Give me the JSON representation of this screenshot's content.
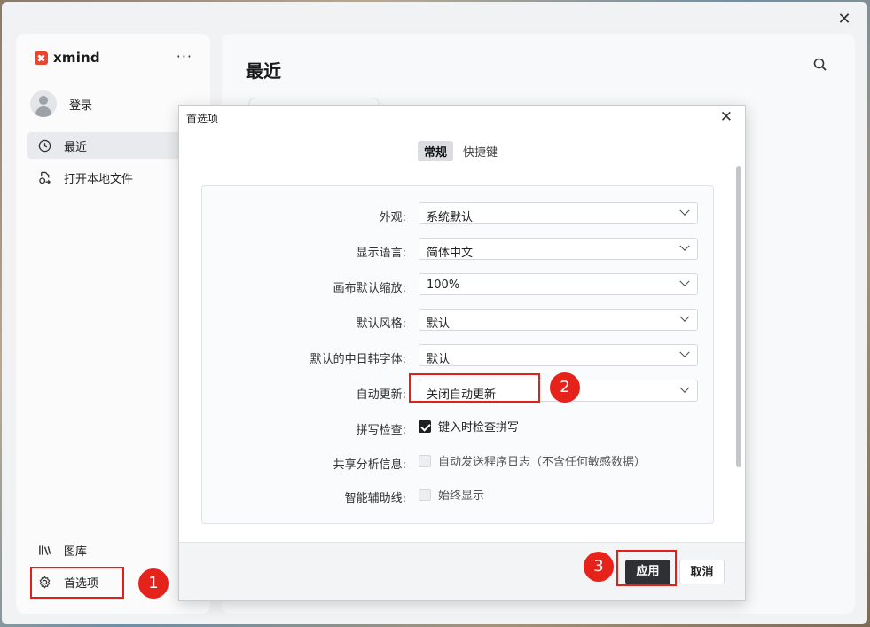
{
  "window": {
    "close_icon": "close-icon"
  },
  "sidebar": {
    "brand": "xmind",
    "more": "···",
    "user_label": "登录",
    "items": [
      {
        "label": "最近",
        "icon": "clock-icon"
      },
      {
        "label": "打开本地文件",
        "icon": "open-file-icon"
      },
      {
        "label": "图库",
        "icon": "library-icon"
      },
      {
        "label": "首选项",
        "icon": "gear-icon"
      }
    ]
  },
  "main": {
    "title": "最近",
    "search_icon": "search-icon"
  },
  "dialog": {
    "title": "首选项",
    "tabs": [
      {
        "label": "常规",
        "active": true
      },
      {
        "label": "快捷键",
        "active": false
      }
    ],
    "settings": [
      {
        "label": "外观:",
        "type": "select",
        "value": "系统默认"
      },
      {
        "label": "显示语言:",
        "type": "select",
        "value": "简体中文"
      },
      {
        "label": "画布默认缩放:",
        "type": "select",
        "value": "100%"
      },
      {
        "label": "默认风格:",
        "type": "select",
        "value": "默认"
      },
      {
        "label": "默认的中日韩字体:",
        "type": "select",
        "value": "默认"
      },
      {
        "label": "自动更新:",
        "type": "select",
        "value": "关闭自动更新"
      },
      {
        "label": "拼写检查:",
        "type": "checkbox",
        "value": "键入时检查拼写",
        "checked": true
      },
      {
        "label": "共享分析信息:",
        "type": "checkbox",
        "value": "自动发送程序日志（不含任何敏感数据）",
        "checked": false
      },
      {
        "label": "智能辅助线:",
        "type": "checkbox",
        "value": "始终显示",
        "checked": false
      }
    ],
    "apply_label": "应用",
    "cancel_label": "取消"
  },
  "annotations": {
    "step1": "1",
    "step2": "2",
    "step3": "3"
  },
  "colors": {
    "highlight": "#e0201b",
    "brand": "#e8442f",
    "apply_bg": "#2f3033"
  }
}
